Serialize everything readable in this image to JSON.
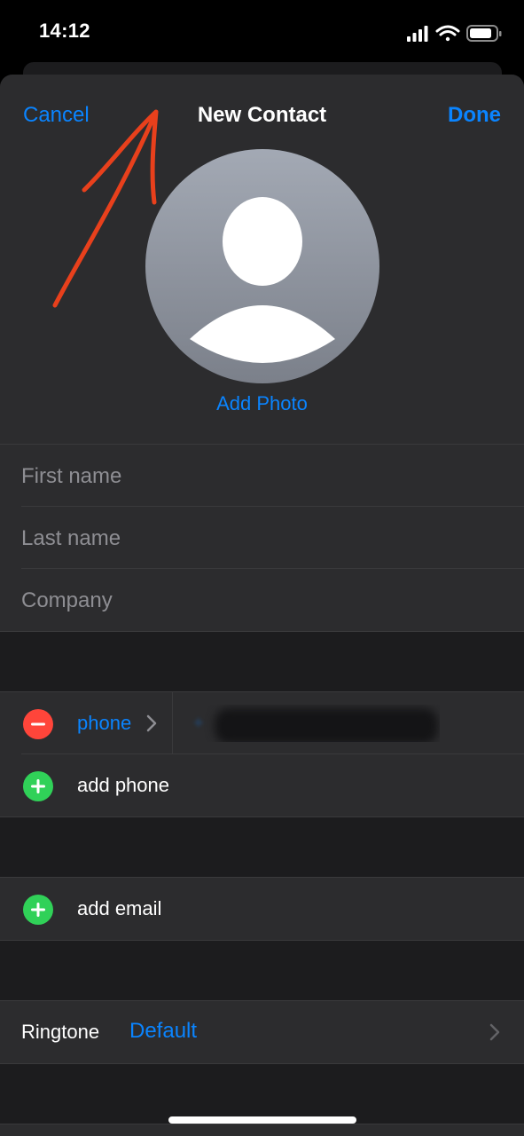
{
  "status_bar": {
    "time": "14:12",
    "icons": [
      "signal-icon",
      "wifi-icon",
      "battery-icon"
    ]
  },
  "nav": {
    "cancel": "Cancel",
    "title": "New Contact",
    "done": "Done"
  },
  "photo": {
    "add_photo": "Add Photo",
    "avatar_icon": "person-silhouette-icon"
  },
  "name_fields": {
    "first_name_placeholder": "First name",
    "last_name_placeholder": "Last name",
    "company_placeholder": "Company"
  },
  "phone_section": {
    "label": "phone",
    "value_hint": "+",
    "add_phone": "add phone"
  },
  "email_section": {
    "add_email": "add email"
  },
  "ringtone": {
    "label": "Ringtone",
    "value": "Default"
  },
  "colors": {
    "accent": "#0a84ff",
    "destructive": "#ff453a",
    "add": "#30d158",
    "cell_background": "#2c2c2e",
    "grouped_background": "#1c1c1e",
    "annotation_stroke": "#e8401c"
  }
}
